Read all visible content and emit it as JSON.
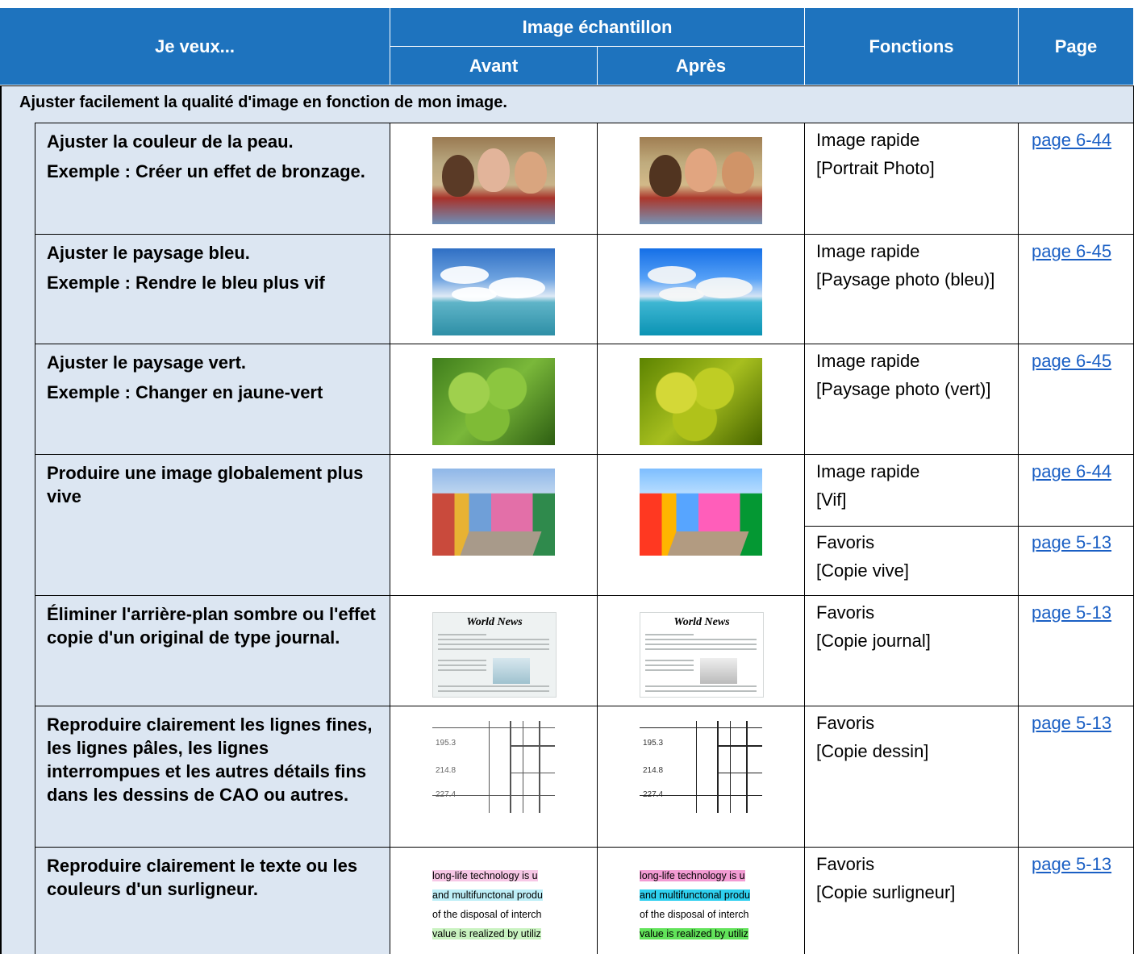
{
  "header": {
    "want": "Je veux...",
    "sample": "Image échantillon",
    "before": "Avant",
    "after": "Après",
    "functions": "Fonctions",
    "page": "Page"
  },
  "section": "Ajuster facilement la qualité d'image en fonction de mon image.",
  "rows": [
    {
      "title": "Ajuster la couleur de la peau.",
      "example": "Exemple : Créer un effet de bronzage.",
      "image_subject": "portrait-photo",
      "functions": [
        {
          "name": "Image rapide",
          "option": "[Portrait Photo]",
          "page": "page 6-44"
        }
      ]
    },
    {
      "title": "Ajuster le paysage bleu.",
      "example": "Exemple : Rendre le bleu plus vif",
      "image_subject": "blue-sky-sea",
      "functions": [
        {
          "name": "Image rapide",
          "option": "[Paysage photo (bleu)]",
          "page": "page 6-45"
        }
      ]
    },
    {
      "title": "Ajuster le paysage vert.",
      "example": "Exemple : Changer en jaune-vert",
      "image_subject": "green-clover",
      "functions": [
        {
          "name": "Image rapide",
          "option": "[Paysage photo (vert)]",
          "page": "page 6-45"
        }
      ]
    },
    {
      "title": "Produire une image globalement plus vive",
      "example": "",
      "image_subject": "colorful-street",
      "functions": [
        {
          "name": "Image rapide",
          "option": "[Vif]",
          "page": "page 6-44"
        },
        {
          "name": "Favoris",
          "option": "[Copie vive]",
          "page": "page 5-13"
        }
      ]
    },
    {
      "title": "Éliminer l'arrière-plan sombre ou l'effet copie d'un original de type journal.",
      "example": "",
      "image_subject": "newspaper",
      "news_heading": "World News",
      "functions": [
        {
          "name": "Favoris",
          "option": "[Copie journal]",
          "page": "page 5-13"
        }
      ]
    },
    {
      "title": "Reproduire clairement les lignes fines, les lignes pâles, les lignes interrompues et les autres détails fins dans les dessins de CAO ou autres.",
      "example": "",
      "image_subject": "cad-drawing",
      "cad_values": [
        "195.3",
        "214.8",
        "227.4"
      ],
      "functions": [
        {
          "name": "Favoris",
          "option": "[Copie dessin]",
          "page": "page 5-13"
        }
      ]
    },
    {
      "title": "Reproduire clairement le texte ou les couleurs d'un surligneur.",
      "example": "",
      "image_subject": "highlighter-text",
      "highlight_lines": [
        "long-life technology is u",
        "and multifunctonal produ",
        "of the disposal of interch",
        "value is realized by utiliz"
      ],
      "functions": [
        {
          "name": "Favoris",
          "option": "[Copie surligneur]",
          "page": "page 5-13"
        }
      ]
    }
  ]
}
